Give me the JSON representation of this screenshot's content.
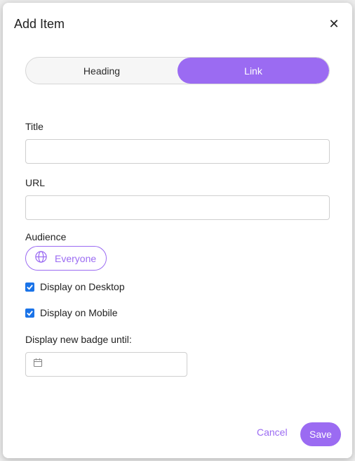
{
  "modal": {
    "title": "Add Item",
    "close_glyph": "✕"
  },
  "segmented": {
    "options": [
      {
        "label": "Heading",
        "active": false
      },
      {
        "label": "Link",
        "active": true
      }
    ]
  },
  "form": {
    "title_label": "Title",
    "title_value": "",
    "url_label": "URL",
    "url_value": "",
    "audience_label": "Audience",
    "audience_value": "Everyone",
    "audience_icon": "globe-icon",
    "desktop_label": "Display on Desktop",
    "desktop_checked": true,
    "mobile_label": "Display on Mobile",
    "mobile_checked": true,
    "badge_label": "Display new badge until:",
    "badge_value": "",
    "badge_icon": "calendar-icon"
  },
  "footer": {
    "cancel_label": "Cancel",
    "save_label": "Save"
  },
  "colors": {
    "accent": "#9b6bf2",
    "checkbox": "#1a73e8"
  }
}
